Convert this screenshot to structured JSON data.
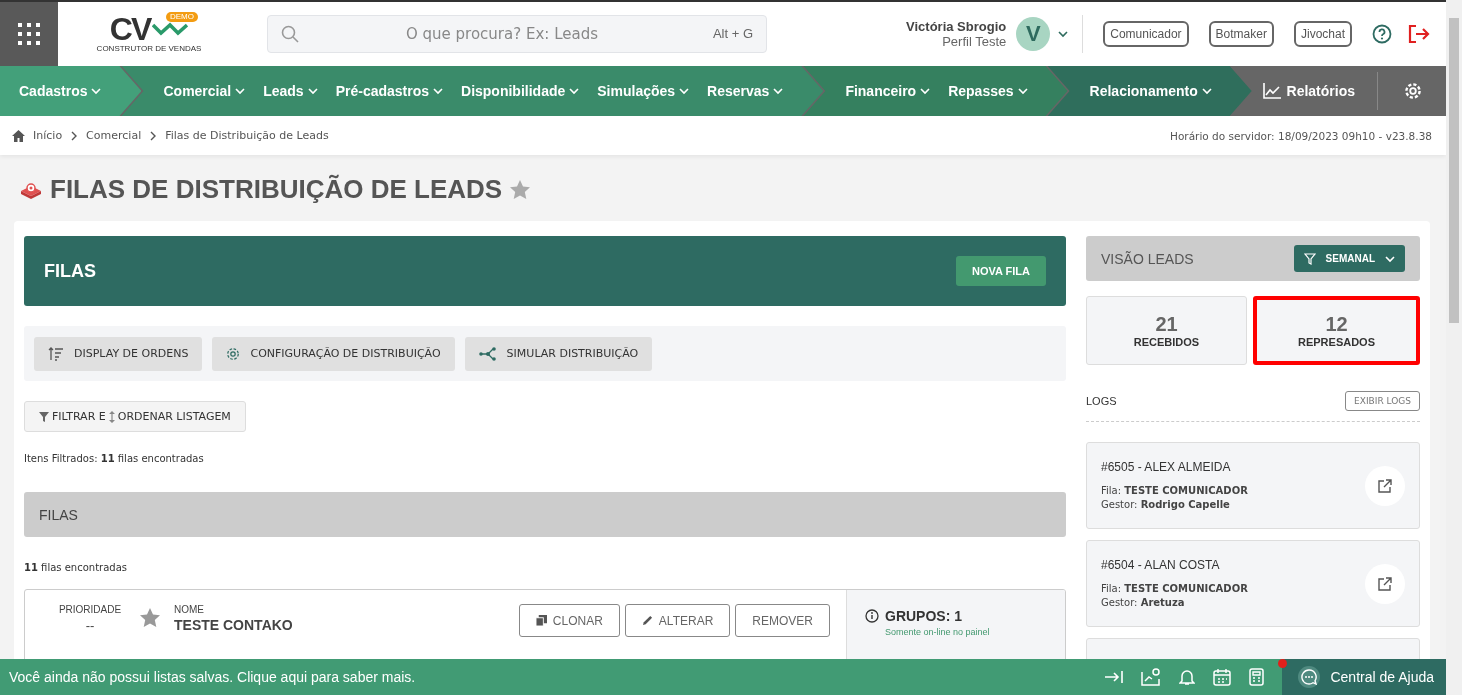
{
  "header": {
    "logo": {
      "letters": "CV",
      "badge": "DEMO",
      "tagline": "CONSTRUTOR DE VENDAS"
    },
    "search": {
      "placeholder": "O que procura? Ex: Leads",
      "shortcut": "Alt + G"
    },
    "user": {
      "name": "Victória Sbrogio",
      "profile": "Perfil Teste",
      "initial": "V"
    },
    "buttons": [
      "Comunicador",
      "Botmaker",
      "Jivochat"
    ]
  },
  "nav": {
    "groups": [
      {
        "items": [
          "Cadastros"
        ]
      },
      {
        "items": [
          "Comercial",
          "Leads",
          "Pré-cadastros",
          "Disponibilidade",
          "Simulações",
          "Reservas"
        ]
      },
      {
        "items": [
          "Financeiro",
          "Repasses"
        ]
      },
      {
        "items": [
          "Relacionamento"
        ]
      }
    ],
    "reports": "Relatórios"
  },
  "breadcrumb": {
    "items": [
      "Início",
      "Comercial",
      "Filas de Distribuição de Leads"
    ],
    "server_time": "Horário do servidor: 18/09/2023 09h10 - v23.8.38"
  },
  "page_title": "FILAS DE DISTRIBUIÇÃO DE LEADS",
  "filas_panel": {
    "title": "FILAS",
    "new_button": "NOVA FILA"
  },
  "toolbar": [
    {
      "kind": "order",
      "label": "DISPLAY DE ORDENS"
    },
    {
      "kind": "config",
      "label": "CONFIGURAÇÃO DE DISTRIBUIÇÃO"
    },
    {
      "kind": "simulate",
      "label": "SIMULAR DISTRIBUIÇÃO"
    }
  ],
  "filter_button": {
    "part_1": "FILTRAR E",
    "part_2": "ORDENAR LISTAGEM"
  },
  "filtered_info": "Itens Filtrados: **11** filas encontradas",
  "list_header": "FILAS",
  "found_info": "**11** filas encontradas",
  "rows": [
    {
      "priority_label": "PRIORIDADE",
      "priority": "--",
      "name_label": "NOME",
      "name": "TESTE CONTAKO",
      "actions": [
        "CLONAR",
        "ALTERAR",
        "REMOVER"
      ],
      "groups": "GRUPOS: 1",
      "groups_note": "Somente on-line no painel"
    }
  ],
  "leads_view": {
    "title": "VISÃO LEADS",
    "period": "SEMANAL"
  },
  "stats": [
    {
      "value": "21",
      "label": "RECEBIDOS",
      "highlighted": false
    },
    {
      "value": "12",
      "label": "REPRESADOS",
      "highlighted": true
    }
  ],
  "logs": {
    "title": "LOGS",
    "button": "EXIBIR LOGS",
    "items": [
      {
        "title": "#6505 - ALEX ALMEIDA",
        "fila": "Fila: **TESTE COMUNICADOR**",
        "gestor": "Gestor: **Rodrigo Capelle**"
      },
      {
        "title": "#6504 - ALAN COSTA",
        "fila": "Fila: **TESTE COMUNICADOR**",
        "gestor": "Gestor: **Aretuza**"
      }
    ]
  },
  "bottom_bar": {
    "message": "Você ainda não possui listas salvas. Clique aqui para saber mais.",
    "help": "Central de Ajuda",
    "help_notification": true
  }
}
